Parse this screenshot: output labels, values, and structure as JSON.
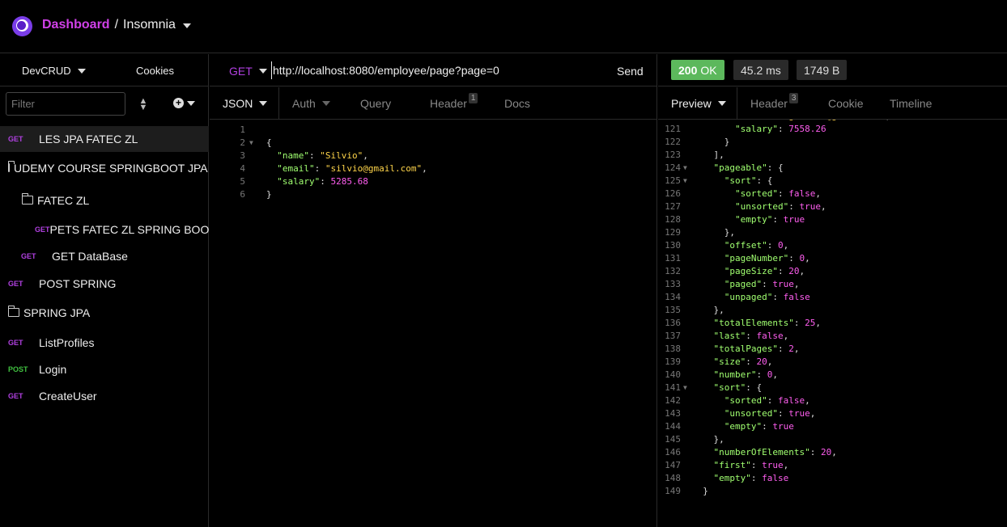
{
  "header": {
    "breadcrumb_dashboard": "Dashboard",
    "breadcrumb_sep": "/",
    "workspace": "Insomnia",
    "brand_color": "#d040e8"
  },
  "sidebar": {
    "project": "DevCRUD",
    "cookies": "Cookies",
    "filter_placeholder": "Filter",
    "items": [
      {
        "type": "request",
        "method": "GET",
        "label": "LES JPA FATEC ZL",
        "active": true
      },
      {
        "type": "folder",
        "label": "UDEMY COURSE SPRINGBOOT JPA (..."
      },
      {
        "type": "folder",
        "label": "FATEC ZL"
      },
      {
        "type": "request",
        "method": "GET",
        "label": "PETS FATEC ZL SPRING BOOT"
      },
      {
        "type": "request",
        "method": "GET",
        "label": "GET DataBase"
      },
      {
        "type": "request",
        "method": "GET",
        "label": "POST SPRING"
      },
      {
        "type": "folder",
        "label": "SPRING JPA"
      },
      {
        "type": "request",
        "method": "GET",
        "label": "ListProfiles"
      },
      {
        "type": "request",
        "method": "POST",
        "label": "Login"
      },
      {
        "type": "request",
        "method": "GET",
        "label": "CreateUser"
      }
    ]
  },
  "request": {
    "method": "GET",
    "url": "http://localhost:8080/employee/page?page=0",
    "send_label": "Send",
    "tabs": [
      {
        "label": "JSON",
        "active": true
      },
      {
        "label": "Auth"
      },
      {
        "label": "Query"
      },
      {
        "label": "Header",
        "badge": "1"
      },
      {
        "label": "Docs"
      }
    ],
    "body_lines": [
      "",
      "{",
      "  \"name\": \"Silvio\",",
      "  \"email\": \"silvio@gmail.com\",",
      "  \"salary\": 5285.68",
      "}"
    ]
  },
  "response": {
    "status": "200",
    "status_text": "OK",
    "time": "45.2 ms",
    "size": "1749 B",
    "tabs": [
      {
        "label": "Preview",
        "active": true
      },
      {
        "label": "Header",
        "badge": "3"
      },
      {
        "label": "Cookie"
      },
      {
        "label": "Timeline"
      }
    ],
    "first_line_number": 120,
    "lines": [
      "        \"email\": \"gabriel@gmail.com\",",
      "        \"salary\": 7558.26",
      "      }",
      "    ],",
      "    \"pageable\": {",
      "      \"sort\": {",
      "        \"sorted\": false,",
      "        \"unsorted\": true,",
      "        \"empty\": true",
      "      },",
      "      \"offset\": 0,",
      "      \"pageNumber\": 0,",
      "      \"pageSize\": 20,",
      "      \"paged\": true,",
      "      \"unpaged\": false",
      "    },",
      "    \"totalElements\": 25,",
      "    \"last\": false,",
      "    \"totalPages\": 2,",
      "    \"size\": 20,",
      "    \"number\": 0,",
      "    \"sort\": {",
      "      \"sorted\": false,",
      "      \"unsorted\": true,",
      "      \"empty\": true",
      "    },",
      "    \"numberOfElements\": 20,",
      "    \"first\": true,",
      "    \"empty\": false",
      "  }"
    ]
  }
}
